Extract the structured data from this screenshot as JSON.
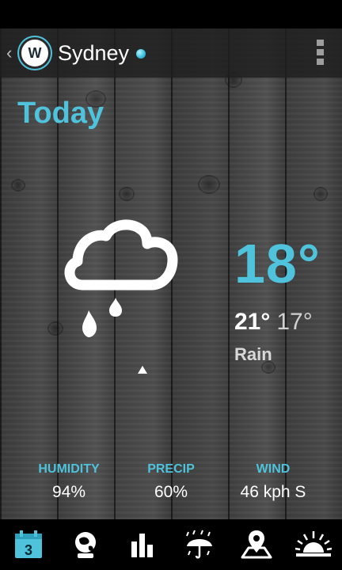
{
  "header": {
    "city": "Sydney",
    "logo_letter": "W"
  },
  "main": {
    "day_label": "Today",
    "current_temp": "18°",
    "high_temp": "21°",
    "low_temp": "17°",
    "condition": "Rain",
    "weather_icon": "cloud-rain-icon"
  },
  "stats": [
    {
      "label": "HUMIDITY",
      "value": "94%"
    },
    {
      "label": "PRECIP",
      "value": "60%"
    },
    {
      "label": "WIND",
      "value": "46 kph S"
    }
  ],
  "nav": {
    "items": [
      {
        "icon": "calendar-icon",
        "badge": "3",
        "active": true
      },
      {
        "icon": "globe-icon",
        "active": false
      },
      {
        "icon": "bar-chart-icon",
        "active": false
      },
      {
        "icon": "umbrella-rain-icon",
        "active": false
      },
      {
        "icon": "map-marker-icon",
        "active": false
      },
      {
        "icon": "sunset-icon",
        "active": false
      }
    ]
  },
  "colors": {
    "accent": "#4fc3dc",
    "background": "#4a4a4a",
    "navbar": "#000000"
  }
}
